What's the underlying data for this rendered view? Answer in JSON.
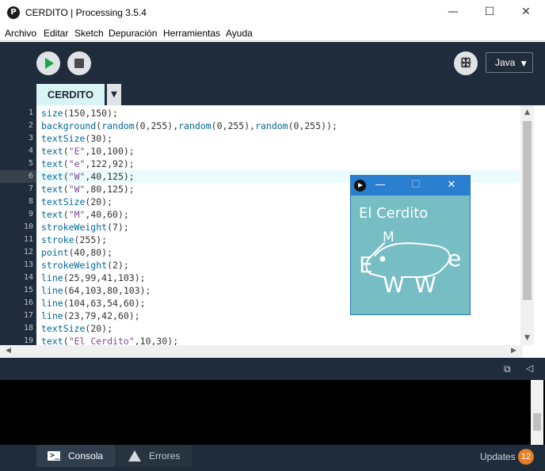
{
  "window": {
    "title": "CERDITO | Processing 3.5.4",
    "minimize": "—",
    "maximize": "☐",
    "close": "✕"
  },
  "menu": [
    "Archivo",
    "Editar",
    "Sketch",
    "Depuración",
    "Herramientas",
    "Ayuda"
  ],
  "toolbar": {
    "mode": "Java",
    "mode_arrow": "▼"
  },
  "tabs": {
    "active": "CERDITO",
    "menu_arrow": "▼"
  },
  "editor": {
    "highlighted_line": 6,
    "lines": [
      {
        "n": "1",
        "fn": "size",
        "rest": "(150,150);"
      },
      {
        "n": "2",
        "fn": "background",
        "rest": "(random(0,255),random(0,255),random(0,255));"
      },
      {
        "n": "3",
        "fn": "textSize",
        "rest": "(30);"
      },
      {
        "n": "4",
        "fn": "text",
        "rest": "(\"E\",10,100);"
      },
      {
        "n": "5",
        "fn": "text",
        "rest": "(\"e\",122,92);"
      },
      {
        "n": "6",
        "fn": "text",
        "rest": "(\"W\",40,125);"
      },
      {
        "n": "7",
        "fn": "text",
        "rest": "(\"W\",80,125);"
      },
      {
        "n": "8",
        "fn": "textSize",
        "rest": "(20);"
      },
      {
        "n": "9",
        "fn": "text",
        "rest": "(\"M\",40,60);"
      },
      {
        "n": "10",
        "fn": "strokeWeight",
        "rest": "(7);"
      },
      {
        "n": "11",
        "fn": "stroke",
        "rest": "(255);"
      },
      {
        "n": "12",
        "fn": "point",
        "rest": "(40,80);"
      },
      {
        "n": "13",
        "fn": "strokeWeight",
        "rest": "(2);"
      },
      {
        "n": "14",
        "fn": "line",
        "rest": "(25,99,41,103);"
      },
      {
        "n": "15",
        "fn": "line",
        "rest": "(64,103,80,103);"
      },
      {
        "n": "16",
        "fn": "line",
        "rest": "(104,63,54,60);"
      },
      {
        "n": "17",
        "fn": "line",
        "rest": "(23,79,42,60);"
      },
      {
        "n": "18",
        "fn": "textSize",
        "rest": "(20);"
      },
      {
        "n": "19",
        "fn": "text",
        "rest": "(\"El Cerdito\",10,30);"
      }
    ]
  },
  "sketch_window": {
    "minimize": "—",
    "maximize": "☐",
    "close": "✕",
    "background": "#76bdc4",
    "caption": "El Cerdito",
    "letters": {
      "E": "E",
      "e": "e",
      "W1": "W",
      "W2": "W",
      "M": "M"
    }
  },
  "footer": {
    "console_tab": "Consola",
    "errors_tab": "Errores",
    "updates_label": "Updates",
    "updates_count": "12"
  },
  "colors": {
    "ide_dark": "#1f2c3c",
    "tab_active": "#d8f4f4",
    "run_green": "#17a846",
    "function_blue": "#006699",
    "badge_orange": "#e67e22"
  }
}
